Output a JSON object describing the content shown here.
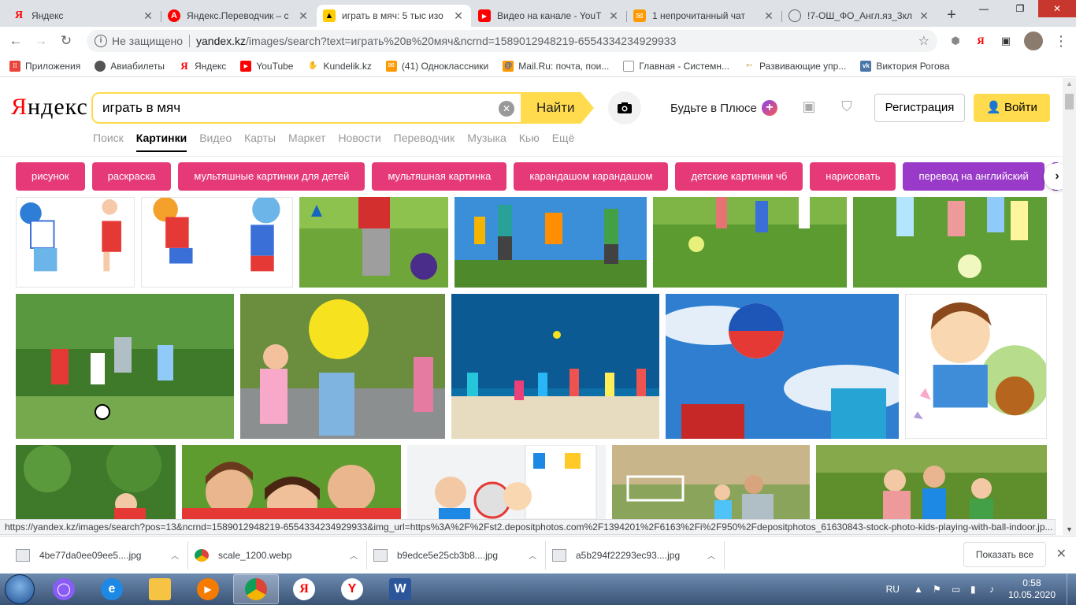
{
  "tabs": [
    {
      "title": "Яндекс",
      "active": false
    },
    {
      "title": "Яндекс.Переводчик – с",
      "active": false
    },
    {
      "title": "играть в мяч: 5 тыс изо",
      "active": true
    },
    {
      "title": "Видео на канале - YouT",
      "active": false
    },
    {
      "title": "1 непрочитанный чат",
      "active": false
    },
    {
      "title": "!7-ОШ_ФО_Англ.яз_3кл",
      "active": false
    }
  ],
  "address": {
    "security_label": "Не защищено",
    "host": "yandex.kz",
    "path": "/images/search?text=играть%20в%20мяч&ncrnd=1589012948219-6554334234929933"
  },
  "bookmarks": [
    "Приложения",
    "Авиабилеты",
    "Яндекс",
    "YouTube",
    "Kundelik.kz",
    "(41) Одноклассники",
    "Mail.Ru: почта, пои...",
    "Главная - Системн...",
    "Развивающие упр...",
    "Виктория Рогова"
  ],
  "yandex": {
    "logo": "Яндекс",
    "query": "играть в мяч",
    "find_label": "Найти",
    "plus_label": "Будьте в Плюсе",
    "register_label": "Регистрация",
    "login_label": "Войти",
    "services": [
      "Поиск",
      "Картинки",
      "Видео",
      "Карты",
      "Маркет",
      "Новости",
      "Переводчик",
      "Музыка",
      "Кью",
      "Ещё"
    ],
    "chips": [
      "рисунок",
      "раскраска",
      "мультяшные картинки для детей",
      "мультяшная картинка",
      "карандашом карандашом",
      "детские картинки чб",
      "нарисовать",
      "перевод на английский"
    ]
  },
  "status_url": "https://yandex.kz/images/search?pos=13&ncrnd=1589012948219-6554334234929933&img_url=https%3A%2F%2Fst2.depositphotos.com%2F1394201%2F6163%2Fi%2F950%2Fdepositphotos_61630843-stock-photo-kids-playing-with-ball-indoor.jp...",
  "downloads": [
    {
      "name": "4be77da0ee09ee5....jpg",
      "icon": "image-file-icon"
    },
    {
      "name": "scale_1200.webp",
      "icon": "chrome-icon"
    },
    {
      "name": "b9edce5e25cb3b8....jpg",
      "icon": "image-file-icon"
    },
    {
      "name": "a5b294f22293ec93....jpg",
      "icon": "image-file-icon"
    }
  ],
  "downloads_show_all": "Показать все",
  "taskbar": {
    "lang": "RU",
    "time": "0:58",
    "date": "10.05.2020"
  },
  "colors": {
    "yandex_yellow": "#ffdb4d",
    "chip_pink": "#e63a78",
    "chip_violet": "#9a3ac9"
  }
}
